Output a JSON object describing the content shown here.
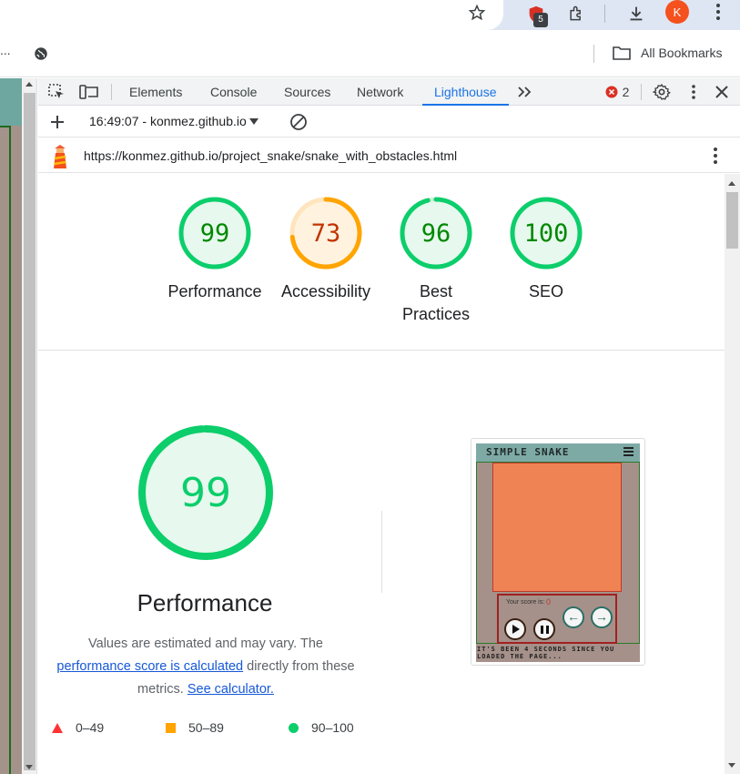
{
  "browser": {
    "profile_initial": "K",
    "extension_badge": "5",
    "bookmarks_label": "All Bookmarks",
    "address_trail": "..."
  },
  "devtools": {
    "tabs": [
      {
        "label": "Elements",
        "active": false
      },
      {
        "label": "Console",
        "active": false
      },
      {
        "label": "Sources",
        "active": false
      },
      {
        "label": "Network",
        "active": false
      },
      {
        "label": "Lighthouse",
        "active": true
      }
    ],
    "error_count": "2",
    "report_selector": "16:49:07 - konmez.github.io",
    "report_url": "https://konmez.github.io/project_snake/snake_with_obstacles.html"
  },
  "scores": [
    {
      "label": "Performance",
      "value": 99,
      "status": "pass"
    },
    {
      "label": "Accessibility",
      "value": 73,
      "status": "average"
    },
    {
      "label": "Best Practices",
      "value": 96,
      "status": "pass"
    },
    {
      "label": "SEO",
      "value": 100,
      "status": "pass"
    }
  ],
  "performance": {
    "score": "99",
    "title": "Performance",
    "desc_1": "Values are estimated and may vary. The",
    "link_1": "performance score is calculated",
    "desc_2": "directly from these",
    "desc_3": "metrics.",
    "link_2": "See calculator."
  },
  "legend": [
    {
      "range": "0–49",
      "color": "#f33"
    },
    {
      "range": "50–89",
      "color": "#ffa400"
    },
    {
      "range": "90–100",
      "color": "#0cce6b"
    }
  ],
  "thumbnail": {
    "title": "SIMPLE SNAKE",
    "score_label": "Your score is:",
    "score_value": "0",
    "footer": "IT'S BEEN 4 SECONDS SINCE YOU LOADED THE PAGE..."
  },
  "colors": {
    "pass": "#0cce6b",
    "pass_text": "#008800",
    "average": "#ffa400",
    "average_text": "#c33300",
    "accent": "#1a73e8"
  }
}
